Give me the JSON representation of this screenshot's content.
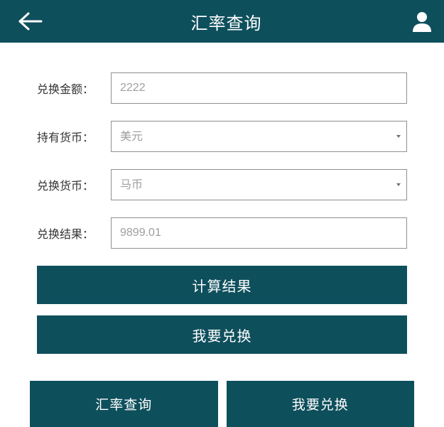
{
  "header": {
    "title": "汇率查询"
  },
  "form": {
    "amount": {
      "label": "兑换金额：",
      "value": "2222"
    },
    "from_currency": {
      "label": "持有货币：",
      "value": "美元"
    },
    "to_currency": {
      "label": "兑换货币：",
      "value": "马币"
    },
    "result": {
      "label": "兑换结果：",
      "value": "9899.01"
    }
  },
  "buttons": {
    "calculate": "计算结果",
    "exchange": "我要兑换"
  },
  "nav": {
    "rate_query": "汇率查询",
    "want_exchange": "我要兑换"
  }
}
